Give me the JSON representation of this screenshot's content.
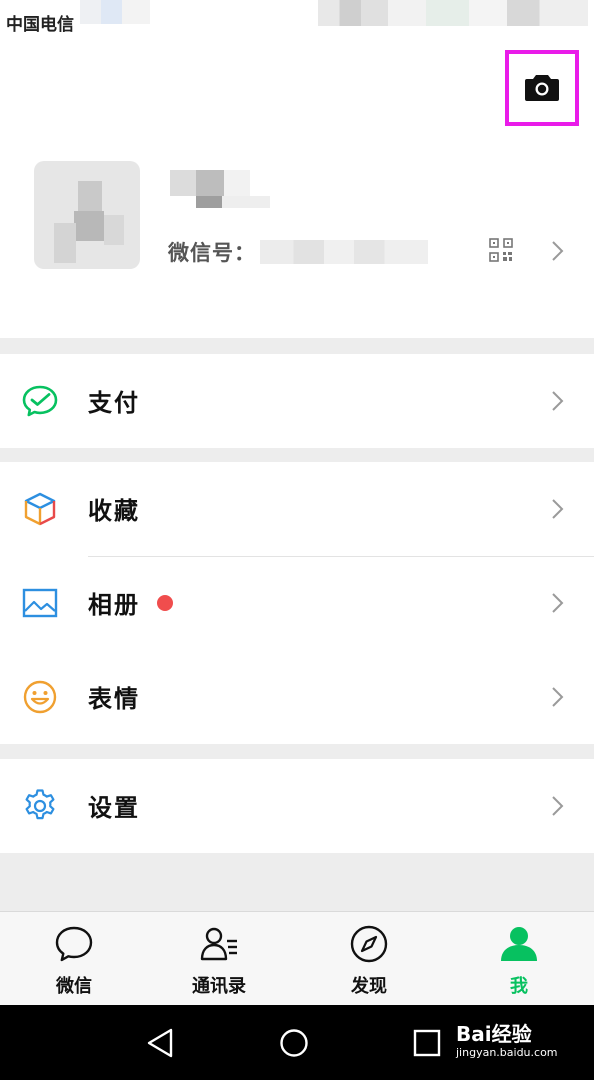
{
  "status_bar": {
    "carrier": "中国电信"
  },
  "profile": {
    "wechat_id_label": "微信号："
  },
  "menu": {
    "pay": {
      "label": "支付",
      "icon": "wechat-pay-icon"
    },
    "favorites": {
      "label": "收藏",
      "icon": "cube-icon"
    },
    "album": {
      "label": "相册",
      "icon": "image-icon",
      "has_badge": true
    },
    "stickers": {
      "label": "表情",
      "icon": "smiley-icon"
    },
    "settings": {
      "label": "设置",
      "icon": "gear-icon"
    }
  },
  "tabs": [
    {
      "label": "微信",
      "icon": "chat-bubble-icon",
      "active": false
    },
    {
      "label": "通讯录",
      "icon": "contacts-icon",
      "active": false
    },
    {
      "label": "发现",
      "icon": "compass-icon",
      "active": false
    },
    {
      "label": "我",
      "icon": "person-icon",
      "active": true
    }
  ],
  "watermark": {
    "text": "Bai经验",
    "sub": "jingyan.baidu.com"
  },
  "colors": {
    "accent_green": "#07c160",
    "highlight_magenta": "#e91be9",
    "badge_red": "#f04d4d"
  }
}
